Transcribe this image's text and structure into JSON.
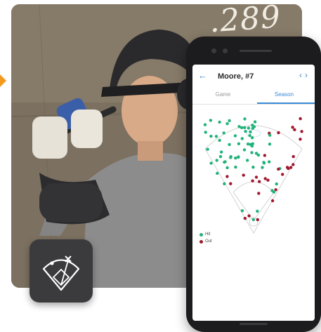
{
  "scene": {
    "stat_overlay": ".289",
    "accent_color": "#f39a1e"
  },
  "app_badge": {
    "icon": "baseball-field-icon"
  },
  "phone": {
    "header": {
      "back_icon": "back-arrow-icon",
      "back_label": "←",
      "player_name": "Moore, #7",
      "prev_label": "‹",
      "next_label": "›"
    },
    "tabs": [
      {
        "label": "Game",
        "active": false
      },
      {
        "label": "Season",
        "active": true
      }
    ],
    "legend": [
      {
        "label": "Hit",
        "color": "#22b37a"
      },
      {
        "label": "Out",
        "color": "#a0182e"
      }
    ],
    "accent_color": "#3a8bd8"
  }
}
